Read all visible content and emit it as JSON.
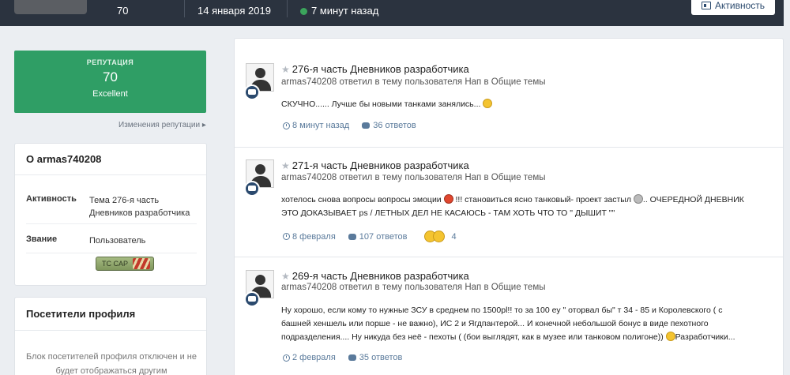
{
  "header": {
    "reputation_value": "70",
    "join_date": "14 января 2019",
    "last_visit": "7 минут назад",
    "activity_button": "Активность"
  },
  "reputation": {
    "label": "РЕПУТАЦИЯ",
    "value": "70",
    "rank": "Excellent",
    "changes_link": "Изменения репутации ▸"
  },
  "about": {
    "title": "О armas740208",
    "activity_label": "Активность",
    "activity_value": "Тема 276-я часть Дневников разработчика",
    "rank_label": "Звание",
    "rank_value": "Пользователь",
    "rank_badge_text": "TC CAP"
  },
  "visitors": {
    "title": "Посетители профиля",
    "text": "Блок посетителей профиля отключен и не будет отображаться другим"
  },
  "feed": [
    {
      "title": "276-я часть Дневников разработчика",
      "subtitle": "armas740208 ответил в тему пользователя Hап в Общие темы",
      "text": "СКУЧНО...... Лучше бы новыми танками занялись...",
      "time": "8 минут назад",
      "replies": "36 ответов"
    },
    {
      "title": "271-я часть Дневников разработчика",
      "subtitle": "armas740208 ответил в тему пользователя Hап в Общие темы",
      "text_1": "хотелось снова вопросы вопросы эмоции",
      "text_2": "!!! становиться ясно танковый- проект застыл",
      "text_3": ".. ОЧЕРЕДНОЙ ДНЕВНИК",
      "text_4": "ЭТО ДОКАЗЫВАЕТ ps / ЛЕТНЫХ ДЕЛ НЕ КАСАЮСЬ - ТАМ ХОТЬ ЧТО ТО \" ДЫШИТ \"\"",
      "time": "8 февраля",
      "replies": "107 ответов",
      "reactions": "4"
    },
    {
      "title": "269-я часть Дневников разработчика",
      "subtitle": "armas740208 ответил в тему пользователя Hап в Общие темы",
      "text_1": "Ну хорошо, если кому то нужные ЗСУ в среднем по 1500рl!! то за 100 еу \" оторвал бы\" т 34 - 85 и Королевского ( с",
      "text_2": "башней хеншель или порше - не важно), ИС 2 и Ягдпантерой... И конечной небольшой бонус в виде пехотного",
      "text_3": "подразделения.... Ну никуда без неё - пехоты ( (бои выглядят, как в музее или танковом полигоне))",
      "text_4": "Разработчики...",
      "time": "2 февраля",
      "replies": "35 ответов"
    }
  ]
}
